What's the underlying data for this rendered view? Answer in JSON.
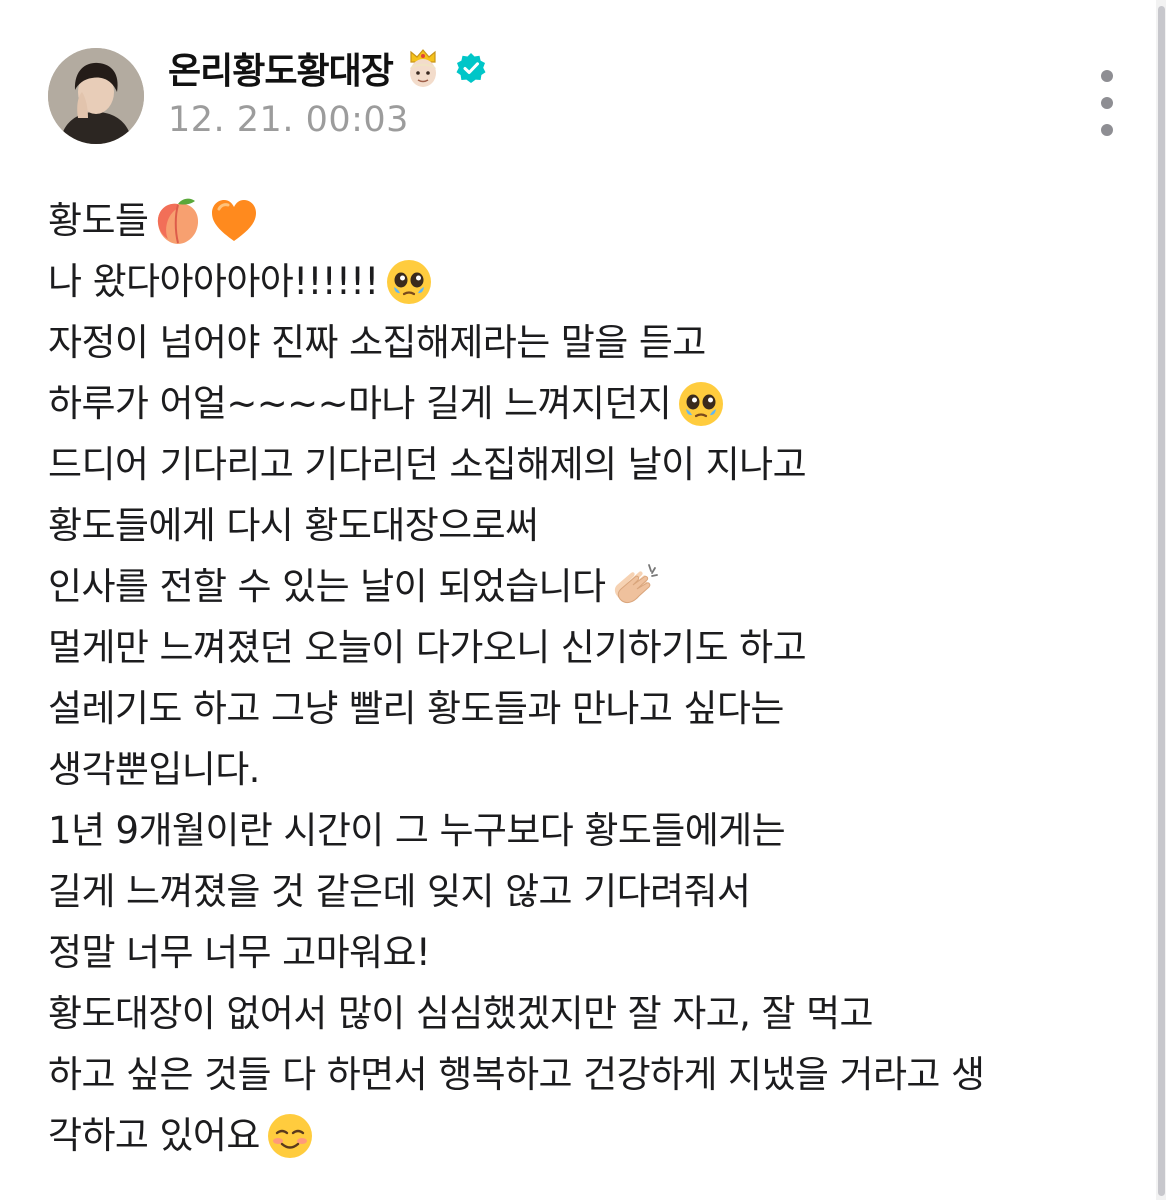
{
  "author": {
    "name": "온리황도황대장",
    "timestamp": "12. 21. 00:03"
  },
  "icons": {
    "avatar": "profile-photo",
    "crown": "prince-emoji",
    "verified": "verified-badge-icon",
    "more": "more-vertical-icon"
  },
  "colors": {
    "verified": "#00c6c8",
    "timestamp": "#9c9c9c",
    "text": "#1c1c1e"
  },
  "body": {
    "lines": [
      "황도들",
      "나 왔다아아아아!!!!!!",
      "자정이 넘어야 진짜 소집해제라는 말을 듣고",
      "하루가 어얼~~~~마나 길게 느껴지던지",
      "드디어 기다리고 기다리던 소집해제의 날이 지나고",
      "황도들에게 다시 황도대장으로써",
      "인사를 전할 수 있는 날이 되었습니다",
      "멀게만 느껴졌던 오늘이 다가오니 신기하기도 하고",
      "설레기도 하고 그냥 빨리 황도들과 만나고 싶다는",
      "생각뿐입니다.",
      "1년 9개월이란 시간이 그 누구보다 황도들에게는",
      "길게 느껴졌을 것 같은데 잊지 않고 기다려줘서",
      "정말 너무 너무 고마워요!",
      "황도대장이 없어서 많이 심심했겠지만 잘 자고, 잘 먹고",
      "하고 싶은 것들 다 하면서 행복하고 건강하게 지냈을 거라고 생",
      "각하고 있어요"
    ]
  }
}
